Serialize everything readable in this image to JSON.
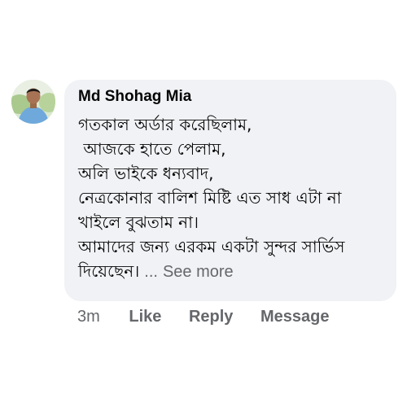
{
  "comment": {
    "author": "Md Shohag Mia",
    "lines": [
      "গতকাল অর্ডার করেছিলাম,",
      " আজকে হাতে পেলাম,",
      "অলি ভাইকে ধন্যবাদ,",
      "নেত্রকোনার বালিশ মিষ্টি এত সাধ এটা না",
      "খাইলে বুঝতাম না।",
      "আমাদের জন্য এরকম একটা সুন্দর সার্ভিস",
      "দিয়েছেন।"
    ],
    "ellipsis": "...",
    "see_more": "See more"
  },
  "actions": {
    "timestamp": "3m",
    "like": "Like",
    "reply": "Reply",
    "message": "Message"
  },
  "colors": {
    "bubble_bg": "#f0f2f5",
    "text": "#050505",
    "muted": "#65676b"
  }
}
